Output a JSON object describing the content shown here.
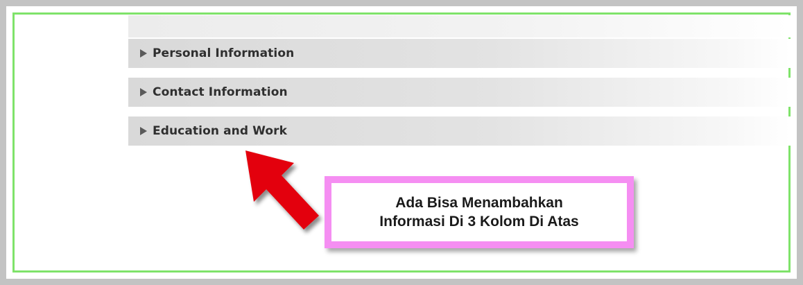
{
  "sections": [
    {
      "label": "Personal Information"
    },
    {
      "label": "Contact Information"
    },
    {
      "label": "Education and Work"
    }
  ],
  "callout": {
    "line1": "Ada Bisa Menambahkan",
    "line2": "Informasi Di 3 Kolom Di Atas"
  },
  "colors": {
    "frame_border": "#c3c3c3",
    "frame_accent": "#7fe36a",
    "callout_border": "#f58ef2",
    "arrow": "#e3000f"
  },
  "icons": [
    "expand-triangle-icon",
    "red-pointer-arrow-icon"
  ]
}
